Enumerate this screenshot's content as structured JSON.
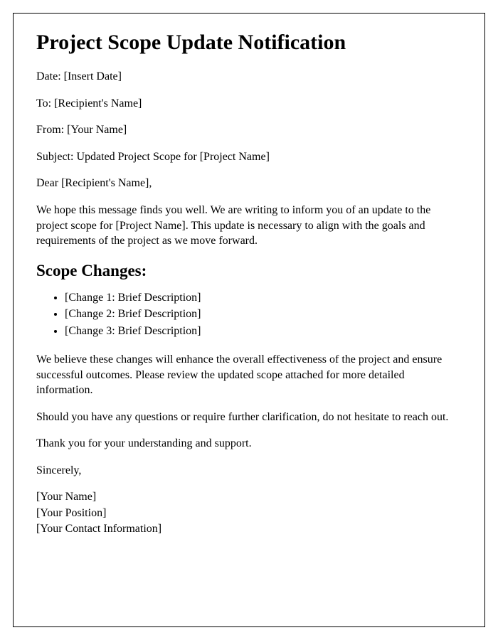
{
  "title": "Project Scope Update Notification",
  "fields": {
    "date": "Date: [Insert Date]",
    "to": "To: [Recipient's Name]",
    "from": "From: [Your Name]",
    "subject": "Subject: Updated Project Scope for [Project Name]"
  },
  "salutation": "Dear [Recipient's Name],",
  "intro": "We hope this message finds you well. We are writing to inform you of an update to the project scope for [Project Name]. This update is necessary to align with the goals and requirements of the project as we move forward.",
  "scope_heading": "Scope Changes:",
  "changes": [
    "[Change 1: Brief Description]",
    "[Change 2: Brief Description]",
    "[Change 3: Brief Description]"
  ],
  "paragraph_after_changes": "We believe these changes will enhance the overall effectiveness of the project and ensure successful outcomes. Please review the updated scope attached for more detailed information.",
  "paragraph_questions": "Should you have any questions or require further clarification, do not hesitate to reach out.",
  "paragraph_thanks": "Thank you for your understanding and support.",
  "closing": "Sincerely,",
  "signature": {
    "name": "[Your Name]",
    "position": "[Your Position]",
    "contact": "[Your Contact Information]"
  }
}
